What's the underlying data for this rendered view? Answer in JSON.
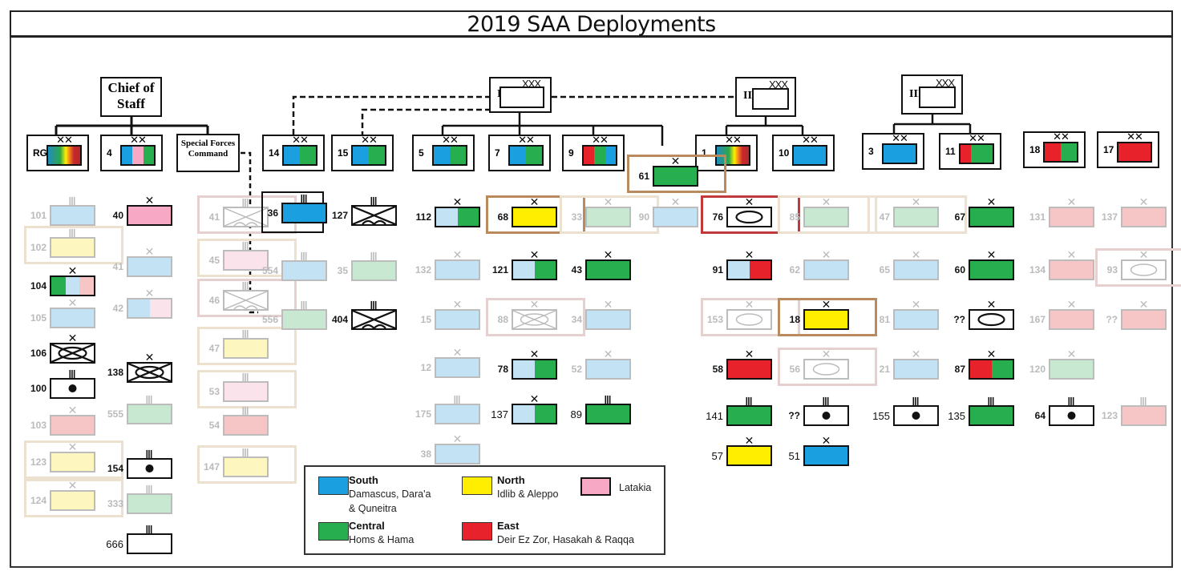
{
  "title": "2019 SAA Deployments",
  "colors": {
    "south": "#1aa0e0",
    "north": "#ffee00",
    "latakia": "#f7a8c4",
    "central": "#27ae4f",
    "east": "#e8222a",
    "south_faded": "#c3e3f5",
    "central_faded": "#c8e8d2",
    "north_faded": "#fdf7bf",
    "latakia_faded": "#fbe3ec",
    "east_faded": "#f6c6c7",
    "frame_tan": "#b98a5e",
    "frame_tan_faded": "#ece0cf",
    "frame_red": "#c0393b",
    "frame_pink_faded": "#e5cfcf"
  },
  "commands": {
    "chief_of_staff": "Chief of Staff",
    "sfc": "Special Forces Command",
    "corps": [
      {
        "id": "I",
        "label": "I",
        "echelon": "XXX"
      },
      {
        "id": "II",
        "label": "II",
        "echelon": "XXX"
      },
      {
        "id": "III",
        "label": "III",
        "echelon": "XXX"
      }
    ]
  },
  "divisions": [
    {
      "label": "RG",
      "echelon": "XX",
      "colors": [
        "rainbow"
      ]
    },
    {
      "label": "4",
      "echelon": "XX",
      "colors": [
        "south",
        "latakia",
        "central"
      ]
    },
    {
      "label": "14",
      "echelon": "XX",
      "colors": [
        "south",
        "central"
      ]
    },
    {
      "label": "15",
      "echelon": "XX",
      "colors": [
        "south",
        "central"
      ]
    },
    {
      "label": "5",
      "echelon": "XX",
      "colors": [
        "south",
        "central"
      ]
    },
    {
      "label": "7",
      "echelon": "XX",
      "colors": [
        "south",
        "central"
      ]
    },
    {
      "label": "9",
      "echelon": "XX",
      "colors": [
        "east",
        "central",
        "south"
      ]
    },
    {
      "label": "1",
      "echelon": "XX",
      "colors": [
        "rainbow"
      ]
    },
    {
      "label": "10",
      "echelon": "XX",
      "colors": [
        "south"
      ]
    },
    {
      "label": "3",
      "echelon": "XX",
      "colors": [
        "south"
      ]
    },
    {
      "label": "11",
      "echelon": "XX",
      "colors": [
        "east",
        "central",
        "central"
      ]
    },
    {
      "label": "18",
      "echelon": "XX",
      "colors": [
        "east",
        "central"
      ]
    },
    {
      "label": "17",
      "echelon": "XX",
      "colors": [
        "east"
      ]
    }
  ],
  "units": {
    "rg": [
      {
        "label": "101",
        "echelon": "III",
        "faded": true,
        "colors": [
          "south_faded"
        ]
      },
      {
        "label": "102",
        "echelon": "III",
        "faded": true,
        "colors": [
          "north_faded"
        ],
        "frame": "frame_tan_faded"
      },
      {
        "label": "104",
        "echelon": "X",
        "faded": false,
        "colors": [
          "central",
          "south_faded",
          "east_faded"
        ]
      },
      {
        "label": "105",
        "echelon": "X",
        "faded": true,
        "colors": [
          "south_faded"
        ]
      },
      {
        "label": "106",
        "echelon": "X",
        "faded": false,
        "colors": [
          "white"
        ],
        "type": "armor-cross"
      },
      {
        "label": "100",
        "echelon": "III",
        "faded": false,
        "colors": [
          "white"
        ],
        "type": "dot"
      },
      {
        "label": "103",
        "echelon": "X",
        "faded": true,
        "colors": [
          "east_faded"
        ]
      },
      {
        "label": "123",
        "echelon": "X",
        "faded": true,
        "colors": [
          "north_faded"
        ],
        "frame": "frame_tan_faded"
      },
      {
        "label": "124",
        "echelon": "X",
        "faded": true,
        "colors": [
          "north_faded"
        ],
        "frame": "frame_tan_faded"
      }
    ],
    "div4": [
      {
        "label": "40",
        "echelon": "X",
        "faded": false,
        "colors": [
          "latakia"
        ]
      },
      {
        "label": "41",
        "echelon": "X",
        "faded": true,
        "colors": [
          "south_faded"
        ]
      },
      {
        "label": "42",
        "echelon": "X",
        "faded": true,
        "colors": [
          "south_faded",
          "latakia_faded"
        ]
      },
      {
        "label": "138",
        "echelon": "X",
        "faded": false,
        "colors": [
          "white"
        ],
        "type": "armor-cross"
      },
      {
        "label": "555",
        "echelon": "III",
        "faded": true,
        "colors": [
          "central_faded"
        ]
      },
      {
        "label": "154",
        "echelon": "III",
        "faded": false,
        "colors": [
          "white"
        ],
        "type": "dot"
      },
      {
        "label": "333",
        "echelon": "III",
        "faded": true,
        "colors": [
          "central_faded"
        ]
      },
      {
        "label": "666",
        "echelon": "III",
        "faded": false,
        "colors": [
          "white"
        ],
        "plain": true
      }
    ],
    "sfc": [
      {
        "label": "41",
        "echelon": "III",
        "faded": true,
        "colors": [
          "white"
        ],
        "type": "airborne",
        "frame": "frame_pink_faded"
      },
      {
        "label": "45",
        "echelon": "III",
        "faded": true,
        "colors": [
          "latakia_faded"
        ],
        "frame": "frame_tan_faded"
      },
      {
        "label": "46",
        "echelon": "III",
        "faded": true,
        "colors": [
          "white"
        ],
        "type": "airborne",
        "frame": "frame_pink_faded"
      },
      {
        "label": "47",
        "echelon": "III",
        "faded": true,
        "colors": [
          "north_faded"
        ],
        "frame": "frame_tan_faded"
      },
      {
        "label": "53",
        "echelon": "III",
        "faded": true,
        "colors": [
          "latakia_faded"
        ],
        "frame": "frame_tan_faded"
      },
      {
        "label": "54",
        "echelon": "III",
        "faded": true,
        "colors": [
          "east_faded"
        ]
      },
      {
        "label": "147",
        "echelon": "III",
        "faded": true,
        "colors": [
          "north_faded"
        ],
        "frame": "frame_tan_faded"
      }
    ],
    "sfc_regiments": [
      {
        "label": "36",
        "echelon": "III",
        "faded": false,
        "colors": [
          "south"
        ],
        "hq_box": true
      },
      {
        "label": "554",
        "echelon": "III",
        "faded": true,
        "colors": [
          "south_faded"
        ]
      },
      {
        "label": "556",
        "echelon": "III",
        "faded": true,
        "colors": [
          "central_faded"
        ]
      }
    ],
    "div14_15": [
      {
        "label": "127",
        "echelon": "III",
        "faded": false,
        "colors": [
          "white"
        ],
        "type": "airborne"
      },
      {
        "label": "35",
        "echelon": "III",
        "faded": true,
        "colors": [
          "central_faded"
        ]
      },
      {
        "label": "404",
        "echelon": "III",
        "faded": false,
        "colors": [
          "white"
        ],
        "type": "airborne"
      }
    ],
    "div5": [
      {
        "label": "112",
        "echelon": "X",
        "faded": false,
        "colors": [
          "south_faded",
          "central"
        ]
      },
      {
        "label": "132",
        "echelon": "X",
        "faded": true,
        "colors": [
          "south_faded"
        ]
      },
      {
        "label": "15",
        "echelon": "X",
        "faded": true,
        "colors": [
          "south_faded"
        ]
      },
      {
        "label": "12",
        "echelon": "X",
        "faded": true,
        "colors": [
          "south_faded"
        ]
      },
      {
        "label": "175",
        "echelon": "III",
        "faded": true,
        "colors": [
          "south_faded"
        ]
      },
      {
        "label": "38",
        "echelon": "X",
        "faded": true,
        "colors": [
          "south_faded"
        ]
      }
    ],
    "div7": [
      {
        "label": "68",
        "echelon": "X",
        "faded": false,
        "colors": [
          "north"
        ],
        "frame": "frame_tan"
      },
      {
        "label": "121",
        "echelon": "X",
        "faded": false,
        "colors": [
          "south_faded",
          "central"
        ]
      },
      {
        "label": "88",
        "echelon": "X",
        "faded": true,
        "colors": [
          "white"
        ],
        "type": "armor-cross",
        "frame": "frame_pink_faded"
      },
      {
        "label": "78",
        "echelon": "X",
        "faded": false,
        "colors": [
          "south_faded",
          "central"
        ]
      },
      {
        "label": "137",
        "echelon": "X",
        "faded": false,
        "colors": [
          "south_faded",
          "central"
        ],
        "plain": true
      }
    ],
    "div9": [
      {
        "label": "33",
        "echelon": "X",
        "faded": true,
        "colors": [
          "central_faded"
        ],
        "frame": "frame_tan_faded"
      },
      {
        "label": "43",
        "echelon": "X",
        "faded": false,
        "colors": [
          "central"
        ]
      },
      {
        "label": "34",
        "echelon": "X",
        "faded": true,
        "colors": [
          "south_faded"
        ]
      },
      {
        "label": "52",
        "echelon": "X",
        "faded": true,
        "colors": [
          "south_faded"
        ]
      },
      {
        "label": "89",
        "echelon": "III",
        "faded": false,
        "colors": [
          "central"
        ],
        "plain": true
      }
    ],
    "corps1_direct": [
      {
        "label": "61",
        "echelon": "X",
        "faded": false,
        "colors": [
          "central"
        ],
        "frame": "frame_tan"
      },
      {
        "label": "90",
        "echelon": "X",
        "faded": true,
        "colors": [
          "south_faded"
        ]
      }
    ],
    "div1": [
      {
        "label": "76",
        "echelon": "X",
        "faded": false,
        "colors": [
          "white"
        ],
        "type": "armor",
        "frame": "frame_red"
      },
      {
        "label": "91",
        "echelon": "X",
        "faded": false,
        "colors": [
          "south_faded",
          "east"
        ]
      },
      {
        "label": "153",
        "echelon": "X",
        "faded": true,
        "colors": [
          "white"
        ],
        "type": "armor",
        "frame": "frame_pink_faded"
      },
      {
        "label": "58",
        "echelon": "X",
        "faded": false,
        "colors": [
          "east"
        ]
      },
      {
        "label": "141",
        "echelon": "III",
        "faded": false,
        "colors": [
          "central"
        ],
        "plain": true
      },
      {
        "label": "57",
        "echelon": "X",
        "faded": false,
        "colors": [
          "north"
        ],
        "plain": true
      }
    ],
    "div10": [
      {
        "label": "85",
        "echelon": "X",
        "faded": true,
        "colors": [
          "central_faded"
        ],
        "frame": "frame_tan_faded"
      },
      {
        "label": "62",
        "echelon": "X",
        "faded": true,
        "colors": [
          "south_faded"
        ]
      },
      {
        "label": "18",
        "echelon": "X",
        "faded": false,
        "colors": [
          "north"
        ],
        "frame": "frame_tan"
      },
      {
        "label": "56",
        "echelon": "X",
        "faded": true,
        "colors": [
          "white"
        ],
        "type": "armor",
        "frame": "frame_pink_faded"
      },
      {
        "label": "??",
        "echelon": "III",
        "faded": false,
        "colors": [
          "white"
        ],
        "type": "dot"
      },
      {
        "label": "51",
        "echelon": "X",
        "faded": false,
        "colors": [
          "south"
        ],
        "plain": true
      }
    ],
    "div3": [
      {
        "label": "47",
        "echelon": "X",
        "faded": true,
        "colors": [
          "central_faded"
        ],
        "frame": "frame_tan_faded"
      },
      {
        "label": "65",
        "echelon": "X",
        "faded": true,
        "colors": [
          "south_faded"
        ]
      },
      {
        "label": "81",
        "echelon": "X",
        "faded": true,
        "colors": [
          "south_faded"
        ]
      },
      {
        "label": "21",
        "echelon": "X",
        "faded": true,
        "colors": [
          "south_faded"
        ]
      },
      {
        "label": "155",
        "echelon": "III",
        "faded": false,
        "colors": [
          "white"
        ],
        "type": "dot",
        "plain": true
      }
    ],
    "div11": [
      {
        "label": "67",
        "echelon": "X",
        "faded": false,
        "colors": [
          "central"
        ]
      },
      {
        "label": "60",
        "echelon": "X",
        "faded": false,
        "colors": [
          "central"
        ]
      },
      {
        "label": "??",
        "echelon": "X",
        "faded": false,
        "colors": [
          "white"
        ],
        "type": "armor"
      },
      {
        "label": "87",
        "echelon": "X",
        "faded": false,
        "colors": [
          "east",
          "central"
        ]
      },
      {
        "label": "135",
        "echelon": "III",
        "faded": false,
        "colors": [
          "central"
        ],
        "plain": true
      }
    ],
    "div18": [
      {
        "label": "131",
        "echelon": "X",
        "faded": true,
        "colors": [
          "east_faded"
        ]
      },
      {
        "label": "134",
        "echelon": "X",
        "faded": true,
        "colors": [
          "east_faded"
        ]
      },
      {
        "label": "167",
        "echelon": "X",
        "faded": true,
        "colors": [
          "east_faded"
        ]
      },
      {
        "label": "120",
        "echelon": "X",
        "faded": true,
        "colors": [
          "central_faded"
        ]
      },
      {
        "label": "64",
        "echelon": "III",
        "faded": false,
        "colors": [
          "white"
        ],
        "type": "dot"
      }
    ],
    "div17": [
      {
        "label": "137",
        "echelon": "X",
        "faded": true,
        "colors": [
          "east_faded"
        ]
      },
      {
        "label": "93",
        "echelon": "X",
        "faded": true,
        "colors": [
          "white"
        ],
        "type": "armor",
        "frame": "frame_pink_faded"
      },
      {
        "label": "??",
        "echelon": "X",
        "faded": true,
        "colors": [
          "east_faded"
        ]
      },
      {
        "label": "123",
        "echelon": "III",
        "faded": true,
        "colors": [
          "east_faded"
        ]
      }
    ]
  },
  "legend": {
    "south": {
      "title": "South",
      "desc": "Damascus, Dara'a",
      "desc2": "& Quneitra"
    },
    "north": {
      "title": "North",
      "desc": "Idlib & Aleppo"
    },
    "latakia": {
      "title": "",
      "desc": "Latakia"
    },
    "central": {
      "title": "Central",
      "desc": "Homs & Hama"
    },
    "east": {
      "title": "East",
      "desc": "Deir Ez Zor, Hasakah & Raqqa"
    }
  }
}
